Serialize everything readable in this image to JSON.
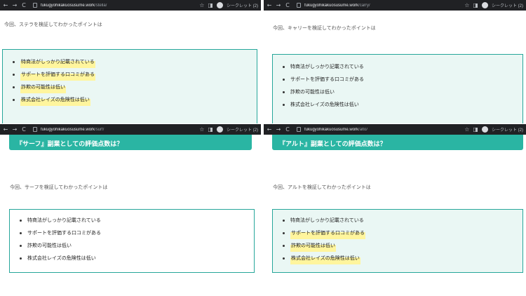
{
  "browser": {
    "back": "←",
    "forward": "→",
    "reload": "C",
    "star": "☆",
    "sidepanel": "◨",
    "secret": "シークレット (2)",
    "menu": "⋮"
  },
  "panels": {
    "tl": {
      "url_domain": "fukugyohikakuosusume.work",
      "url_path": "/stella/",
      "intro": "今回、ステラを検証してわかったポイントは",
      "points": [
        "特商法がしっかり記載されている",
        "サポートを評価する口コミがある",
        "詐欺の可能性は低い",
        "株式会社レイズの危険性は低い"
      ]
    },
    "tr": {
      "url_domain": "fukugyohikakuosusume.work",
      "url_path": "/carry/",
      "intro": "今回、キャリーを検証してわかったポイントは",
      "points": [
        "特商法がしっかり記載されている",
        "サポートを評価する口コミがある",
        "詐欺の可能性は低い",
        "株式会社レイズの危険性は低い"
      ]
    },
    "bl": {
      "url_domain": "fukugyohikakuosusume.work",
      "url_path": "/surf/",
      "banner": "『サーフ』副業としての評価点数は？",
      "intro": "今回、サーフを検証してわかったポイントは",
      "points": [
        "特商法がしっかり記載されている",
        "サポートを評価する口コミがある",
        "詐欺の可能性は低い",
        "株式会社レイズの危険性は低い"
      ]
    },
    "br": {
      "url_domain": "fukugyohikakuosusume.work",
      "url_path": "/alto/",
      "banner": "『アルト』副業としての評価点数は？",
      "intro": "今回、アルトを検証してわかったポイントは",
      "points": [
        "特商法がしっかり記載されている",
        "サポートを評価する口コミがある",
        "詐欺の可能性は低い",
        "株式会社レイズの危険性は低い"
      ]
    }
  },
  "colors": {
    "accent": "#2ab5a3",
    "box_bg": "#eaf7f4",
    "highlight": "#fff59d",
    "chrome_bg": "#202124"
  }
}
